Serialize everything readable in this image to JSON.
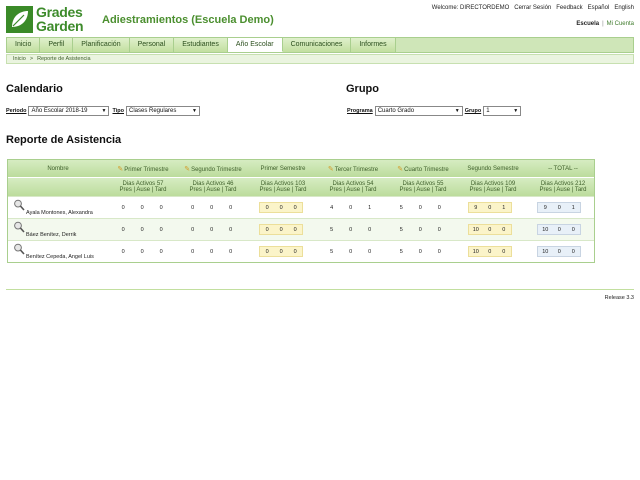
{
  "header": {
    "logo_line1": "Grades",
    "logo_line2": "Garden",
    "school_title": "Adiestramientos (Escuela Demo)",
    "top_links": [
      "Welcome: DIRECTORDEMO",
      "Cerrar Sesión",
      "Feedback",
      "Español",
      "English"
    ],
    "school_link": "Escuela",
    "account_link": "Mi Cuenta",
    "separator": "|"
  },
  "nav": {
    "tabs": [
      "Inicio",
      "Perfil",
      "Planificación",
      "Personal",
      "Estudiantes",
      "Año Escolar",
      "Comunicaciones",
      "Informes"
    ],
    "active": "Año Escolar"
  },
  "breadcrumb": {
    "home": "Inicio",
    "sep": ">",
    "current": "Reporte de Asistencia"
  },
  "calendar": {
    "title": "Calendario",
    "periodo_label": "Periodo",
    "periodo_value": "Año Escolar 2018-19",
    "tipo_label": "Tipo",
    "tipo_value": "Clases Regulares"
  },
  "group": {
    "title": "Grupo",
    "programa_label": "Programa",
    "programa_value": "Cuarto Grado",
    "grupo_label": "Grupo",
    "grupo_value": "1"
  },
  "report": {
    "title": "Reporte de Asistencia",
    "name_header": "Nombre",
    "periods": [
      {
        "name": "Primer Trimestre",
        "sub": "Dias Activos 57",
        "editable": true
      },
      {
        "name": "Segundo Trimestre",
        "sub": "Dias Activos 46",
        "editable": true
      },
      {
        "name": "Primer Semestre",
        "sub": "Dias Activos 103",
        "editable": false
      },
      {
        "name": "Tercer Trimestre",
        "sub": "Dias Activos 54",
        "editable": true
      },
      {
        "name": "Cuarto Trimestre",
        "sub": "Dias Activos 55",
        "editable": true
      },
      {
        "name": "Segundo Semestre",
        "sub": "Dias Activos 109",
        "editable": false
      },
      {
        "name": "-- TOTAL --",
        "sub": "Dias Activos 212",
        "editable": false
      }
    ],
    "subcols": "Pres | Ause | Tard",
    "rows": [
      {
        "name": "Ayala Montones, Alexandra",
        "values": [
          [
            "0",
            "0",
            "0"
          ],
          [
            "0",
            "0",
            "0"
          ],
          [
            "0",
            "0",
            "0"
          ],
          [
            "4",
            "0",
            "1"
          ],
          [
            "5",
            "0",
            "0"
          ],
          [
            "9",
            "0",
            "1"
          ],
          [
            "9",
            "0",
            "1"
          ]
        ]
      },
      {
        "name": "Báez Benítez, Derrik",
        "values": [
          [
            "0",
            "0",
            "0"
          ],
          [
            "0",
            "0",
            "0"
          ],
          [
            "0",
            "0",
            "0"
          ],
          [
            "5",
            "0",
            "0"
          ],
          [
            "5",
            "0",
            "0"
          ],
          [
            "10",
            "0",
            "0"
          ],
          [
            "10",
            "0",
            "0"
          ]
        ]
      },
      {
        "name": "Benítez Cepeda, Angel Luis",
        "values": [
          [
            "0",
            "0",
            "0"
          ],
          [
            "0",
            "0",
            "0"
          ],
          [
            "0",
            "0",
            "0"
          ],
          [
            "5",
            "0",
            "0"
          ],
          [
            "5",
            "0",
            "0"
          ],
          [
            "10",
            "0",
            "0"
          ],
          [
            "10",
            "0",
            "0"
          ]
        ]
      }
    ]
  },
  "footer": {
    "release": "Release 3.3"
  },
  "colors": {
    "brand_green": "#3d8b2b",
    "nav_bg": "#cfe6b8",
    "semester_box": "#fbf4c9",
    "total_box": "#e8f0f8"
  }
}
